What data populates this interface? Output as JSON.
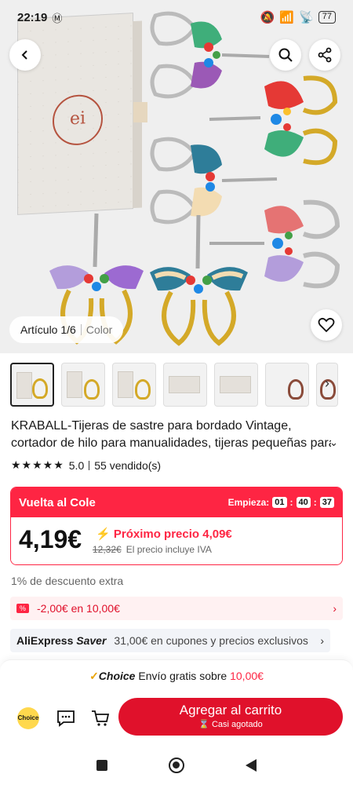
{
  "status_bar": {
    "time": "22:19",
    "carrier_icon": "m-icon",
    "battery": "77"
  },
  "gallery": {
    "item_label": "Artículo",
    "item_counter": "1/6",
    "color_label": "Color",
    "thumbnail_count": 7
  },
  "product": {
    "title_line1": "KRABALL-Tijeras de sastre para bordado Vintage,",
    "title_line2": "cortador de hilo para manualidades, tijeras pequeñas para",
    "rating": "5.0",
    "sold": "55 vendido(s)"
  },
  "promo": {
    "name": "Vuelta al Cole",
    "starts_label": "Empieza:",
    "countdown": [
      "01",
      "40",
      "37"
    ],
    "price": "4,19€",
    "next_price": "Próximo precio 4,09€",
    "old_price": "12,32€",
    "vat_note": "El precio incluye IVA",
    "accent_color": "#fe2543"
  },
  "extra_discount": "1% de descuento extra",
  "coupon": {
    "text": "-2,00€ en 10,00€"
  },
  "saver": {
    "brand": "AliExpress",
    "brand_suffix": "Saver",
    "text": "31,00€ en cupones y precios exclusivos"
  },
  "shipping": {
    "choice": "Choice",
    "text": "Envío gratis sobre",
    "amount": "10,00€"
  },
  "actions": {
    "choice_badge": "Choice",
    "add_to_cart": "Agregar al carrito",
    "low_stock": "Casi agotado",
    "button_color": "#e0112b"
  }
}
